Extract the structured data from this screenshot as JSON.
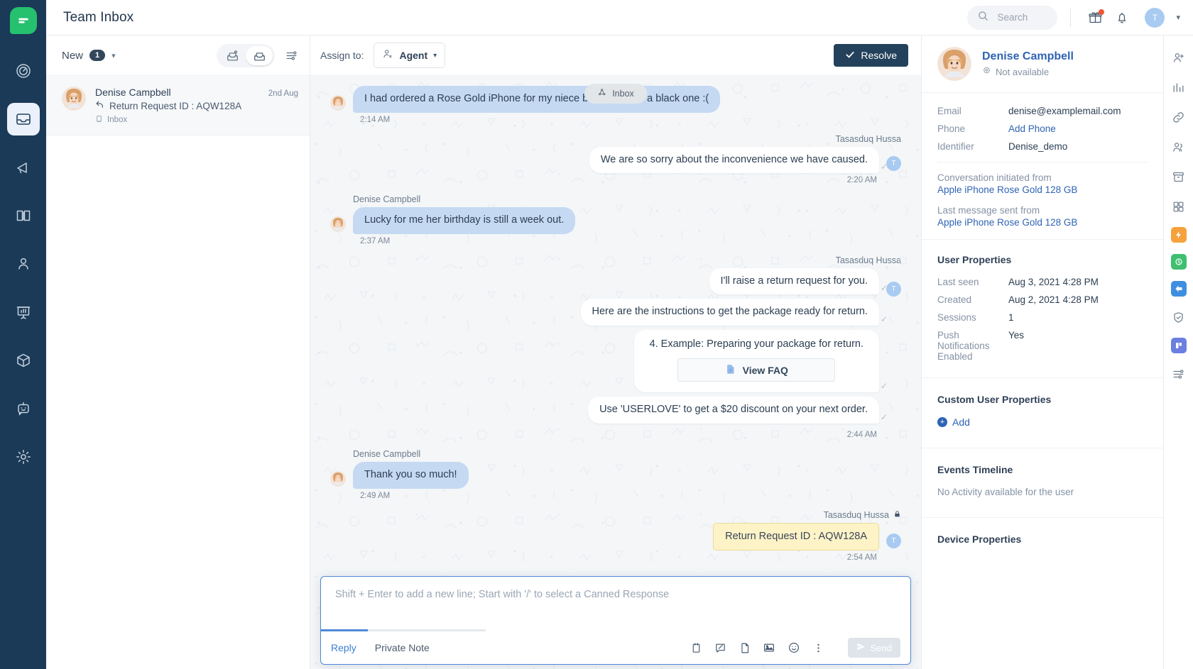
{
  "app": {
    "title": "Team Inbox",
    "brand_color": "#25c16f",
    "nav_bg": "#1b3a57"
  },
  "topbar": {
    "search_placeholder": "Search",
    "gift_badge": true,
    "user_initial": "T",
    "icons": [
      "search-icon",
      "gift-icon",
      "bell-icon"
    ]
  },
  "nav_items": [
    {
      "name": "dashboard-icon",
      "label": "Dashboard",
      "active": false
    },
    {
      "name": "inbox-icon",
      "label": "Inbox",
      "active": true
    },
    {
      "name": "campaign-icon",
      "label": "Campaigns",
      "active": false
    },
    {
      "name": "knowledge-base-icon",
      "label": "Knowledge Base",
      "active": false
    },
    {
      "name": "contacts-icon",
      "label": "Contacts",
      "active": false
    },
    {
      "name": "reports-icon",
      "label": "Reports",
      "active": false
    },
    {
      "name": "apps-icon",
      "label": "Apps",
      "active": false
    },
    {
      "name": "bot-icon",
      "label": "Bots",
      "active": false
    },
    {
      "name": "settings-icon",
      "label": "Settings",
      "active": false
    }
  ],
  "conversation_list": {
    "filter_label": "New",
    "filter_count": "1",
    "segment_left": "unassigned-inbox-icon",
    "segment_right": "assigned-inbox-icon",
    "filter_icon": "sliders-icon",
    "items": [
      {
        "name": "Denise Campbell",
        "date": "2nd Aug",
        "snippet": "Return Request ID : AQW128A",
        "channel": "Inbox",
        "selected": true
      }
    ]
  },
  "chat_header": {
    "assign_label": "Assign to:",
    "assignee": "Agent",
    "resolve_label": "Resolve"
  },
  "inbox_chip": "Inbox",
  "messages": [
    {
      "id": "m1",
      "side": "left",
      "sender": "",
      "text": "I had ordered a Rose Gold iPhone for my niece but I received a black one :(",
      "time": "2:14 AM",
      "type": "customer"
    },
    {
      "id": "m2",
      "side": "right",
      "sender": "Tasasduq Hussa",
      "text": "We are so sorry about the inconvenience we have caused.",
      "time": "2:20 AM",
      "type": "agent"
    },
    {
      "id": "m3",
      "side": "left",
      "sender": "Denise Campbell",
      "text": "Lucky for me her birthday is still a week out.",
      "time": "2:37 AM",
      "type": "customer"
    },
    {
      "id": "m4",
      "side": "right",
      "sender": "Tasasduq Hussa",
      "time": "2:44 AM",
      "type": "agent-group",
      "lines": [
        "I'll raise a return request for you.",
        "Here are the instructions to get the package ready for return.",
        "4. Example: Preparing your package for return.",
        "Use 'USERLOVE' to get a $20 discount on your next order."
      ],
      "faq_button": "View FAQ"
    },
    {
      "id": "m5",
      "side": "left",
      "sender": "Denise Campbell",
      "text": "Thank you so much!",
      "time": "2:49 AM",
      "type": "customer"
    },
    {
      "id": "m6",
      "side": "right",
      "sender": "Tasasduq Hussa",
      "text": "Return Request ID : AQW128A",
      "time": "2:54 AM",
      "type": "private-note",
      "locked": true
    }
  ],
  "composer": {
    "placeholder": "Shift + Enter to add a new line; Start with '/' to select a Canned Response",
    "value": "",
    "tab_reply": "Reply",
    "tab_private_note": "Private Note",
    "send_label": "Send",
    "tools": [
      "calendar-icon",
      "canned-response-icon",
      "attach-file-icon",
      "image-icon",
      "emoji-icon",
      "more-options-icon"
    ]
  },
  "right_panel": {
    "user_name": "Denise Campbell",
    "user_status": "Not available",
    "fields": [
      {
        "key": "Email",
        "value": "denise@examplemail.com",
        "link": false
      },
      {
        "key": "Phone",
        "value": "Add Phone",
        "link": true
      },
      {
        "key": "Identifier",
        "value": "Denise_demo",
        "link": false
      }
    ],
    "sources": [
      {
        "label": "Conversation initiated from",
        "value": "Apple iPhone Rose Gold 128 GB"
      },
      {
        "label": "Last message sent from",
        "value": "Apple iPhone Rose Gold 128 GB"
      }
    ],
    "user_properties_title": "User Properties",
    "user_properties": [
      {
        "key": "Last seen",
        "value": "Aug 3, 2021 4:28 PM"
      },
      {
        "key": "Created",
        "value": "Aug 2, 2021 4:28 PM"
      },
      {
        "key": "Sessions",
        "value": "1"
      },
      {
        "key": "Push Notifications Enabled",
        "value": "Yes"
      }
    ],
    "custom_props_title": "Custom User Properties",
    "custom_props_add": "Add",
    "events_title": "Events Timeline",
    "events_empty": "No Activity available for the user",
    "device_title": "Device Properties"
  },
  "tool_rail": [
    {
      "name": "person-add-icon",
      "color": "#5a6b7d"
    },
    {
      "name": "analytics-icon",
      "color": "#5a6b7d"
    },
    {
      "name": "link-icon",
      "color": "#5a6b7d"
    },
    {
      "name": "people-icon",
      "color": "#5a6b7d"
    },
    {
      "name": "archive-icon",
      "color": "#5a6b7d"
    },
    {
      "name": "grid-icon",
      "color": "#5a6b7d"
    },
    {
      "name": "app-orange-icon",
      "color": "#f6a13c"
    },
    {
      "name": "app-green-icon",
      "color": "#3fbf6f"
    },
    {
      "name": "app-blue-icon",
      "color": "#3f8fe0"
    },
    {
      "name": "app-shield-icon",
      "color": "#5a6b7d"
    },
    {
      "name": "app-indigo-icon",
      "color": "#6b7fe0"
    },
    {
      "name": "app-settings-icon",
      "color": "#5a6b7d"
    }
  ]
}
